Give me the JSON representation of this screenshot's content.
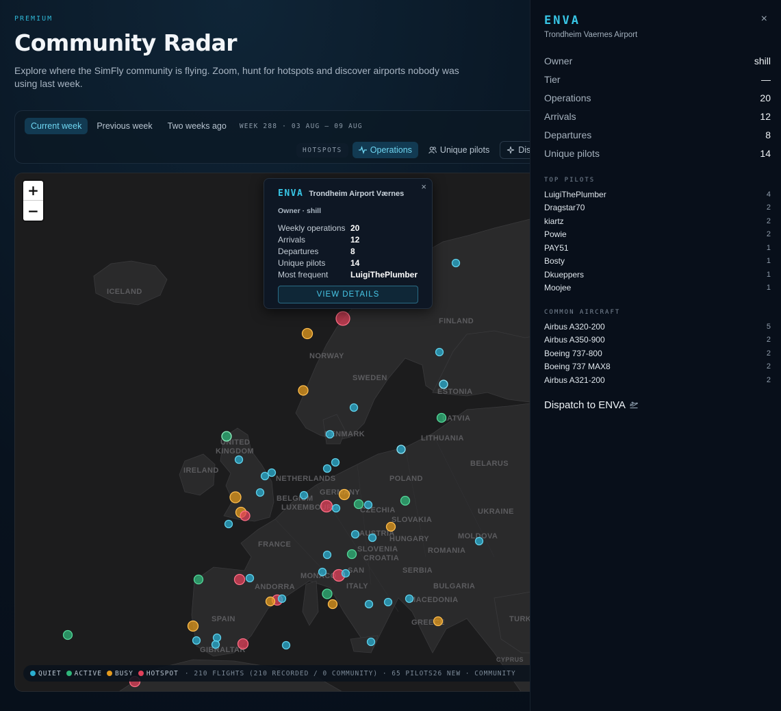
{
  "header": {
    "eyebrow": "PREMIUM",
    "title": "Community Radar",
    "subtitle": "Explore where the SimFly community is flying. Zoom, hunt for hotspots and discover airports nobody was using last week."
  },
  "controls": {
    "week_tabs": [
      {
        "label": "Current week",
        "active": true
      },
      {
        "label": "Previous week",
        "active": false
      },
      {
        "label": "Two weeks ago",
        "active": false
      }
    ],
    "week_label": "WEEK 288 · 03 AUG – 09 AUG",
    "metric_label": "HOTSPOTS",
    "metrics": [
      {
        "label": "Operations",
        "icon": "activity-icon",
        "active": true
      },
      {
        "label": "Unique pilots",
        "icon": "users-icon",
        "active": false
      },
      {
        "label": "Dis",
        "icon": "sparkle-icon",
        "active": false
      }
    ]
  },
  "map": {
    "zoom_in": "+",
    "zoom_out": "−",
    "countries": [
      {
        "name": "ICELAND"
      },
      {
        "name": "NORWAY"
      },
      {
        "name": "SWEDEN"
      },
      {
        "name": "FINLAND"
      },
      {
        "name": "ESTONIA"
      },
      {
        "name": "LATVIA"
      },
      {
        "name": "LITHUANIA"
      },
      {
        "name": "DENMARK"
      },
      {
        "name": "UNITED"
      },
      {
        "name": "KINGDOM"
      },
      {
        "name": "IRELAND"
      },
      {
        "name": "NETHERLANDS"
      },
      {
        "name": "BELGIUM"
      },
      {
        "name": "LUXEMBOURG"
      },
      {
        "name": "GERMANY"
      },
      {
        "name": "POLAND"
      },
      {
        "name": "BELARUS"
      },
      {
        "name": "UKRAINE"
      },
      {
        "name": "CZECHIA"
      },
      {
        "name": "SLOVAKIA"
      },
      {
        "name": "AUSTRIA"
      },
      {
        "name": "HUNGARY"
      },
      {
        "name": "MOLDOVA"
      },
      {
        "name": "ROMANIA"
      },
      {
        "name": "FRANCE"
      },
      {
        "name": "SLOVENIA"
      },
      {
        "name": "CROATIA"
      },
      {
        "name": "SERBIA"
      },
      {
        "name": "BULGARIA"
      },
      {
        "name": "MONACO"
      },
      {
        "name": "SAN"
      },
      {
        "name": "ITALY"
      },
      {
        "name": "MACEDONIA"
      },
      {
        "name": "ANDORRA"
      },
      {
        "name": "SPAIN"
      },
      {
        "name": "GIBRALTAR"
      },
      {
        "name": "GREECE"
      },
      {
        "name": "TURK"
      },
      {
        "name": "CYPRUS"
      }
    ],
    "colors": {
      "quiet": "#2aaed0",
      "active": "#2fb57a",
      "busy": "#e39a1e",
      "hotspot": "#e0405a"
    },
    "legend": {
      "quiet": "QUIET",
      "active": "ACTIVE",
      "busy": "BUSY",
      "hotspot": "HOTSPOT",
      "stats": "· 210 FLIGHTS (210 RECORDED / 0 COMMUNITY) · 65 PILOTS26 NEW · COMMUNITY"
    }
  },
  "popup": {
    "icao": "ENVA",
    "name": "Trondheim Airport Værnes",
    "owner": "Owner · shill",
    "rows": [
      {
        "label": "Weekly operations",
        "value": "20"
      },
      {
        "label": "Arrivals",
        "value": "12"
      },
      {
        "label": "Departures",
        "value": "8"
      },
      {
        "label": "Unique pilots",
        "value": "14"
      },
      {
        "label": "Most frequent",
        "value": "LuigiThePlumber"
      }
    ],
    "button": "VIEW DETAILS",
    "close": "×"
  },
  "panel": {
    "icao": "ENVA",
    "name": "Trondheim Vaernes Airport",
    "close": "×",
    "stats": [
      {
        "label": "Owner",
        "value": "shill"
      },
      {
        "label": "Tier",
        "value": "—"
      },
      {
        "label": "Operations",
        "value": "20"
      },
      {
        "label": "Arrivals",
        "value": "12"
      },
      {
        "label": "Departures",
        "value": "8"
      },
      {
        "label": "Unique pilots",
        "value": "14"
      }
    ],
    "top_pilots_label": "TOP PILOTS",
    "top_pilots": [
      {
        "name": "LuigiThePlumber",
        "count": "4"
      },
      {
        "name": "Dragstar70",
        "count": "2"
      },
      {
        "name": "kiartz",
        "count": "2"
      },
      {
        "name": "Powie",
        "count": "2"
      },
      {
        "name": "PAY51",
        "count": "1"
      },
      {
        "name": "Bosty",
        "count": "1"
      },
      {
        "name": "Dkueppers",
        "count": "1"
      },
      {
        "name": "Moojee",
        "count": "1"
      }
    ],
    "aircraft_label": "COMMON AIRCRAFT",
    "aircraft": [
      {
        "name": "Airbus A320-200",
        "count": "5"
      },
      {
        "name": "Airbus A350-900",
        "count": "2"
      },
      {
        "name": "Boeing 737-800",
        "count": "2"
      },
      {
        "name": "Boeing 737 MAX8",
        "count": "2"
      },
      {
        "name": "Airbus A321-200",
        "count": "2"
      }
    ],
    "dispatch": "Dispatch to ENVA",
    "dispatch_icon": "plane-takeoff-icon"
  }
}
